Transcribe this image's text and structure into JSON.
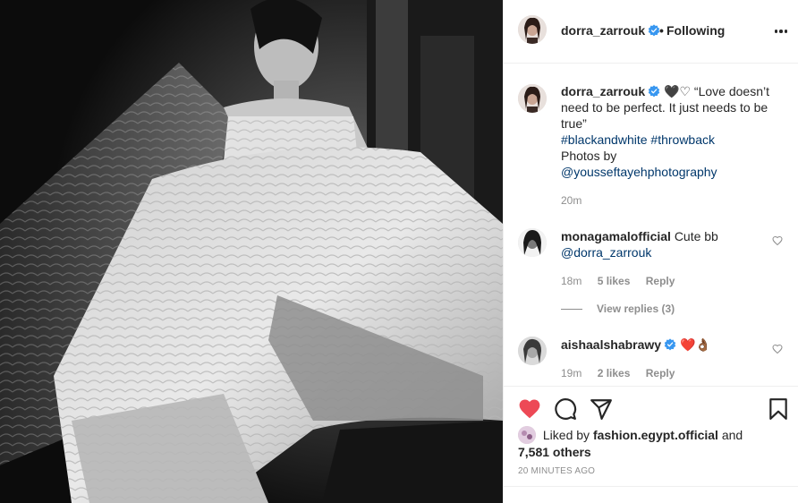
{
  "header": {
    "username": "dorra_zarrouk",
    "separator": "•",
    "follow_status": "Following"
  },
  "caption": {
    "username": "dorra_zarrouk",
    "hearts": "🖤♡",
    "text": "“Love doesn’t need to be perfect. It just needs to be true”",
    "hashtags": [
      "#blackandwhite",
      "#throwback"
    ],
    "credit_label": "Photos by",
    "credit_mention": "@yousseftayehphotography",
    "time": "20m"
  },
  "comments": [
    {
      "username": "monagamalofficial",
      "text": "Cute bb",
      "mention": "@dorra_zarrouk",
      "time": "18m",
      "likes": "5 likes",
      "reply_label": "Reply",
      "view_replies": "View replies (3)"
    },
    {
      "username": "aishaalshabrawy",
      "text": "❤️👌🏾",
      "time": "19m",
      "likes": "2 likes",
      "reply_label": "Reply"
    }
  ],
  "liked_by": {
    "prefix": "Liked by",
    "user": "fashion.egypt.official",
    "and": "and",
    "others": "7,581 others"
  },
  "timestamp": "20 minutes ago",
  "icons": {
    "like": "heart-icon",
    "comment": "comment-icon",
    "share": "share-icon",
    "save": "bookmark-icon",
    "verified": "verified-badge-icon",
    "more": "more-options-icon"
  },
  "colors": {
    "like_red": "#ed4956",
    "verified_blue": "#3897f0",
    "link_blue": "#00376b",
    "muted": "#8e8e8e"
  }
}
